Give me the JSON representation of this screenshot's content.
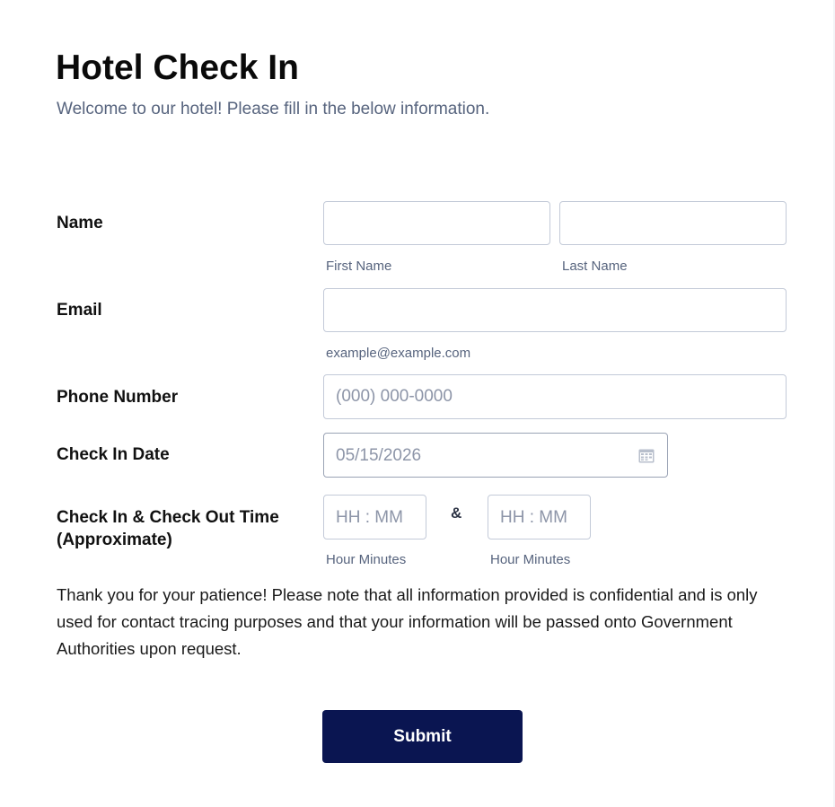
{
  "form": {
    "title": "Hotel Check In",
    "subtitle": "Welcome to our hotel! Please fill in the below information."
  },
  "fields": {
    "name": {
      "label": "Name",
      "first_sublabel": "First Name",
      "last_sublabel": "Last Name",
      "first_value": "",
      "last_value": ""
    },
    "email": {
      "label": "Email",
      "sublabel": "example@example.com",
      "value": ""
    },
    "phone": {
      "label": "Phone Number",
      "placeholder": "(000) 000-0000",
      "value": ""
    },
    "checkin_date": {
      "label": "Check In Date",
      "placeholder": "05/15/2026",
      "icon": "calendar-icon"
    },
    "times": {
      "label_line1": "Check In & Check Out Time",
      "label_line2": "(Approximate)",
      "checkin_placeholder": "HH : MM",
      "checkout_placeholder": "HH : MM",
      "separator": "&",
      "checkin_sublabel": "Hour Minutes",
      "checkout_sublabel": "Hour Minutes"
    }
  },
  "note": "Thank you for your patience! Please note that all information provided is confidential and is only used for contact tracing purposes and that your information will be passed onto Government Authorities upon request.",
  "submit_label": "Submit",
  "colors": {
    "submit_bg": "#0a1551",
    "subtitle": "#57647e",
    "border": "#c3cad8"
  }
}
